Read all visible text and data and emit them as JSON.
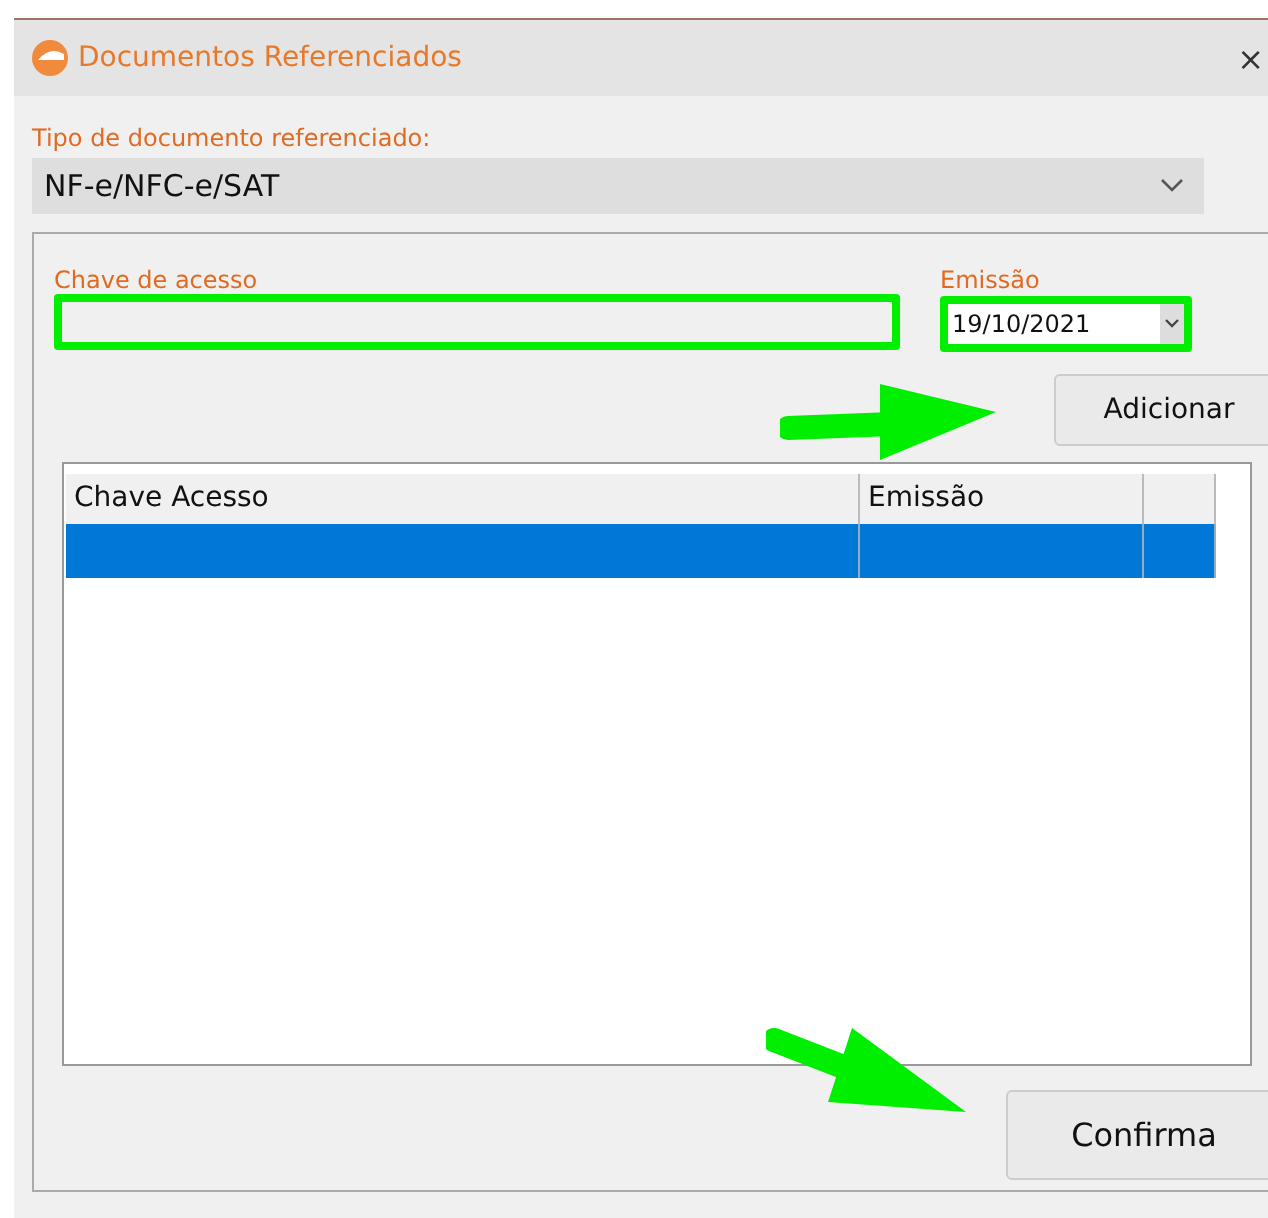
{
  "window": {
    "title": "Documentos Referenciados",
    "close": "×"
  },
  "document_type": {
    "label": "Tipo de documento referenciado:",
    "value": "NF-e/NFC-e/SAT"
  },
  "access_key": {
    "label": "Chave de acesso",
    "highlighted": true
  },
  "issue_date": {
    "label": "Emissão",
    "value": "19/10/2021",
    "highlighted": true
  },
  "add_button": "Adicionar",
  "table": {
    "columns": [
      "Chave Acesso",
      "Emissão"
    ],
    "rows": [
      {
        "selected": true
      }
    ]
  },
  "confirm_button": "Confirma"
}
